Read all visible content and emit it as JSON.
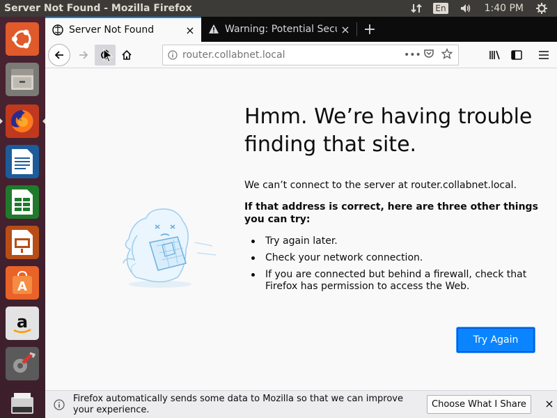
{
  "top_panel": {
    "window_title": "Server Not Found - Mozilla Firefox",
    "lang": "En",
    "clock": "1:40 PM",
    "icons": [
      "network-icon",
      "volume-icon",
      "settings-gear-icon"
    ]
  },
  "launcher": {
    "items": [
      "ubuntu-dash",
      "files",
      "firefox",
      "libreoffice-writer",
      "libreoffice-calc",
      "libreoffice-impress",
      "software-center",
      "amazon",
      "system-settings",
      "trash"
    ]
  },
  "tabs": [
    {
      "label": "Server Not Found",
      "close": "×"
    },
    {
      "label": "Warning: Potential Secu",
      "close": "×"
    }
  ],
  "newtab": "+",
  "url": {
    "value": "router.collabnet.local",
    "actions": [
      "•••",
      "pocket-icon",
      "star-icon"
    ]
  },
  "error": {
    "title": "Hmm. We’re having trouble finding that site.",
    "lead": "We can’t connect to the server at router.collabnet.local.",
    "strong": "If that address is correct, here are three other things you can try:",
    "items": [
      "Try again later.",
      "Check your network connection.",
      "If you are connected but behind a firewall, check that Firefox has permission to access the Web."
    ],
    "button": "Try Again"
  },
  "notification": {
    "text": "Firefox automatically sends some data to Mozilla so that we can improve your experience.",
    "button": "Choose What I Share",
    "close": "×"
  },
  "colors": {
    "accent": "#0a84ff",
    "launcher": "#4a2332",
    "panel": "#3c3b37"
  }
}
